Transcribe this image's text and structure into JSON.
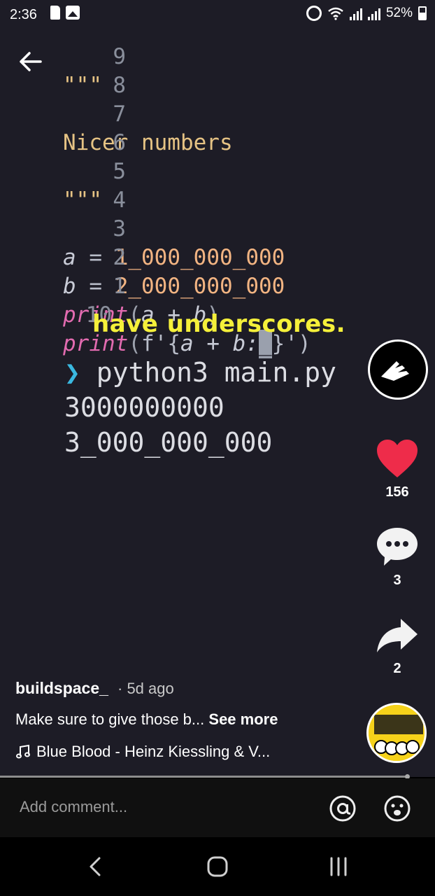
{
  "status_bar": {
    "time": "2:36",
    "battery": "52%"
  },
  "code": {
    "lines": [
      {
        "num": "9",
        "text": "\"\"\""
      },
      {
        "num": "8",
        "text": ""
      },
      {
        "num": "7",
        "text": "Nicer numbers"
      },
      {
        "num": "6",
        "text": ""
      },
      {
        "num": "5",
        "text": "\"\"\""
      },
      {
        "num": "4",
        "text": ""
      },
      {
        "num": "3",
        "var": "a",
        "eq": "=",
        "val": "1_000_000_000"
      },
      {
        "num": "2",
        "var": "b",
        "eq": "=",
        "val": "2_000_000_000"
      },
      {
        "num": "1",
        "fn": "print",
        "args": "a + b"
      },
      {
        "num": "10",
        "fn": "print",
        "fstr_open": "f'{",
        "expr": "a + b:",
        "cursor": "_",
        "fstr_close": "}')"
      }
    ]
  },
  "caption": "have underscores.",
  "terminal": {
    "prompt_symbol": "❯",
    "command": "python3 main.py",
    "output_1": "3000000000",
    "output_2": "3_000_000_000"
  },
  "actions": {
    "likes": "156",
    "comments": "3",
    "shares": "2"
  },
  "post": {
    "username": "buildspace_",
    "time_ago": "· 5d ago",
    "description": "Make sure to give those b...",
    "see_more": "See more",
    "music": "Blue Blood - Heinz Kiessling & V..."
  },
  "comment_bar": {
    "placeholder": "Add comment..."
  },
  "colors": {
    "like_red": "#ee2c4a",
    "caption_yellow": "#f5f03a",
    "video_bg": "#1d1c26"
  }
}
